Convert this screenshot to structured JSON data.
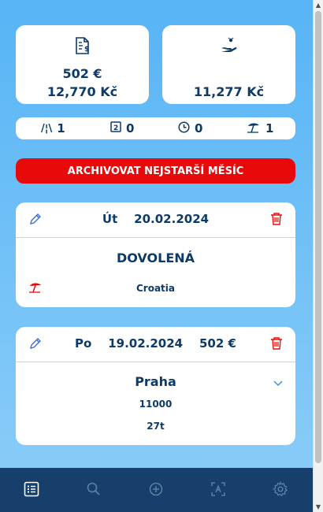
{
  "summary": {
    "expense_card": {
      "icon": "invoice-dollar-icon",
      "amount_eur": "502 €",
      "amount_czk": "12,770 Kč"
    },
    "income_card": {
      "icon": "hand-coin-icon",
      "amount_czk": "11,277 Kč"
    }
  },
  "counters": [
    {
      "icon": "road-icon",
      "value": "1"
    },
    {
      "icon": "numbered-box-icon",
      "value": "0"
    },
    {
      "icon": "clock-icon",
      "value": "0"
    },
    {
      "icon": "beach-umbrella-icon",
      "value": "1"
    }
  ],
  "archive_button": {
    "label": "ARCHIVOVAT NEJSTARŠÍ MĚSÍC"
  },
  "entries": [
    {
      "day": "Út",
      "date": "20.02.2024",
      "amount": "",
      "type": "DOVOLENÁ",
      "location": "Croatia"
    },
    {
      "day": "Po",
      "date": "19.02.2024",
      "amount": "502 €",
      "city": "Praha",
      "line1": "11000",
      "line2": "27t"
    }
  ],
  "nav": {
    "items": [
      "list-icon",
      "search-icon",
      "add-icon",
      "scan-icon",
      "settings-icon"
    ],
    "active": "list-icon"
  },
  "colors": {
    "accent_red": "#e80a0a",
    "navy": "#0d3a67",
    "nav_bg": "#163f6c",
    "edit_blue": "#3d6fd6"
  }
}
